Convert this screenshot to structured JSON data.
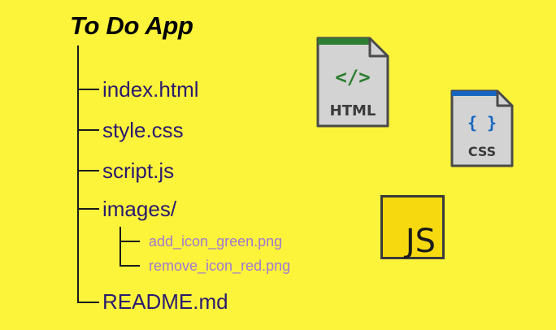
{
  "title": "To Do App",
  "tree": {
    "items": [
      {
        "label": "index.html"
      },
      {
        "label": "style.css"
      },
      {
        "label": "script.js"
      },
      {
        "label": "images/"
      },
      {
        "label": "README.md"
      }
    ],
    "subitems": [
      {
        "label": "add_icon_green.png"
      },
      {
        "label": "remove_icon_red.png"
      }
    ]
  },
  "icons": {
    "html": {
      "symbol": "</>",
      "label": "HTML",
      "accent": "#2e7d32"
    },
    "css": {
      "symbol": "{ }",
      "label": "CSS",
      "accent": "#1565c0"
    },
    "js": {
      "label": "JS"
    }
  },
  "colors": {
    "background": "#fcf33b",
    "item_text": "#2a1b6e",
    "subitem_text": "#a07ad0",
    "tree_line": "#1a1a1a"
  }
}
